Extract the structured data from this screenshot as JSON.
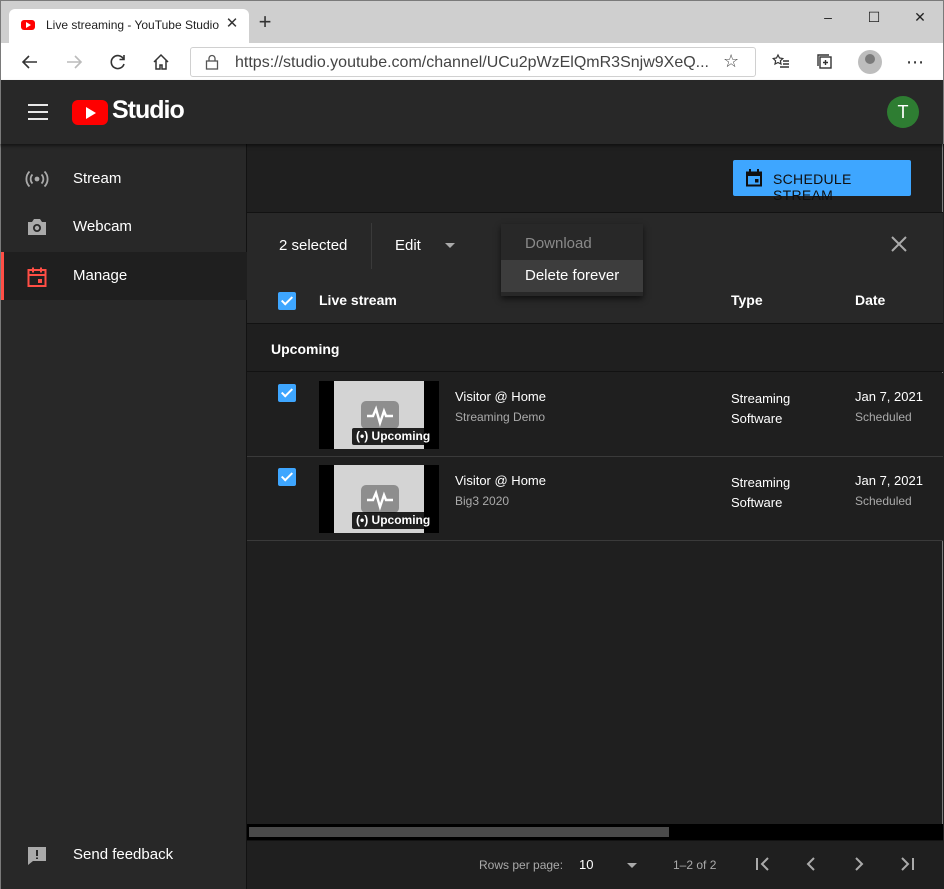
{
  "browser": {
    "tab_title": "Live streaming - YouTube Studio",
    "tab_close": "✕",
    "new_tab": "+",
    "url": "https://studio.youtube.com/channel/UCu2pWzElQmR3Snjw9XeQ...",
    "window_controls": [
      "–",
      "☐",
      "✕"
    ]
  },
  "header": {
    "studio_word": "Studio",
    "avatar_initial": "T",
    "avatar_color": "#2e7d32"
  },
  "sidebar": {
    "items": [
      {
        "label": "Stream",
        "icon": "broadcast-icon"
      },
      {
        "label": "Webcam",
        "icon": "camera-icon"
      },
      {
        "label": "Manage",
        "icon": "calendar-icon",
        "active": true
      }
    ],
    "feedback_label": "Send feedback"
  },
  "toolbar": {
    "schedule_label": "SCHEDULE STREAM",
    "selected_count": "2 selected",
    "edit_label": "Edit",
    "menu": {
      "download": "Download",
      "delete": "Delete forever"
    }
  },
  "table": {
    "headers": {
      "live_stream": "Live stream",
      "type": "Type",
      "date": "Date"
    },
    "group": "Upcoming",
    "rows": [
      {
        "title": "Visitor @ Home",
        "subtitle": "Streaming Demo",
        "badge": "Upcoming",
        "type": "Streaming Software",
        "date": "Jan 7, 2021",
        "status": "Scheduled",
        "checked": true
      },
      {
        "title": "Visitor @ Home",
        "subtitle": "Big3 2020",
        "badge": "Upcoming",
        "type": "Streaming Software",
        "date": "Jan 7, 2021",
        "status": "Scheduled",
        "checked": true
      }
    ]
  },
  "pagination": {
    "rows_per_page_label": "Rows per page:",
    "rows_per_page": "10",
    "range": "1–2 of 2"
  },
  "colors": {
    "accent": "#3ea6ff",
    "active_indicator": "#ff4e45",
    "youtube_red": "#ff0000"
  }
}
